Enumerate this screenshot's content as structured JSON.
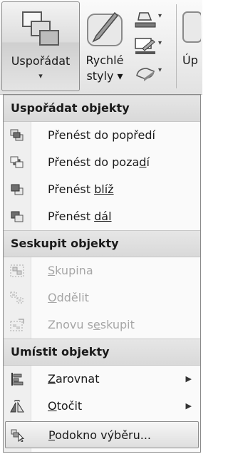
{
  "ribbon": {
    "arrange": {
      "label": "Uspořádat",
      "arrow": "▾",
      "icon": "arrange-icon"
    },
    "quick_styles": {
      "label_line1": "Rychlé",
      "label_line2": "styly ▾",
      "icon": "quick-styles-brush-icon"
    },
    "fill_icon": "fill-bucket-icon",
    "outline_icon": "shape-outline-icon",
    "effects_icon": "shape-effects-icon",
    "dropdown": "▾",
    "cut_label": "Úp"
  },
  "menu": {
    "section1": "Uspořádat objekty",
    "bring_forward": {
      "before": "Přenést do popředí",
      "ul": "",
      "after": ""
    },
    "send_backward": {
      "before": "Přenést do poza",
      "ul": "d",
      "after": "í"
    },
    "bring_closer": {
      "before": "Přenést ",
      "ul": "blíž",
      "after": ""
    },
    "send_further": {
      "before": "Přenést ",
      "ul": "dál",
      "after": ""
    },
    "section2": "Seskupit objekty",
    "group": {
      "before": "",
      "ul": "S",
      "after": "kupina"
    },
    "ungroup": {
      "before": "",
      "ul": "O",
      "after": "ddělit"
    },
    "regroup": {
      "before": "Znovu s",
      "ul": "e",
      "after": "skupit"
    },
    "section3": "Umístit objekty",
    "align": {
      "before": "",
      "ul": "Z",
      "after": "arovnat",
      "submenu": "▶"
    },
    "rotate": {
      "before": "",
      "ul": "O",
      "after": "točit",
      "submenu": "▶"
    },
    "selection_pane": {
      "before": "",
      "ul": "P",
      "after": "odokno výběru..."
    }
  }
}
